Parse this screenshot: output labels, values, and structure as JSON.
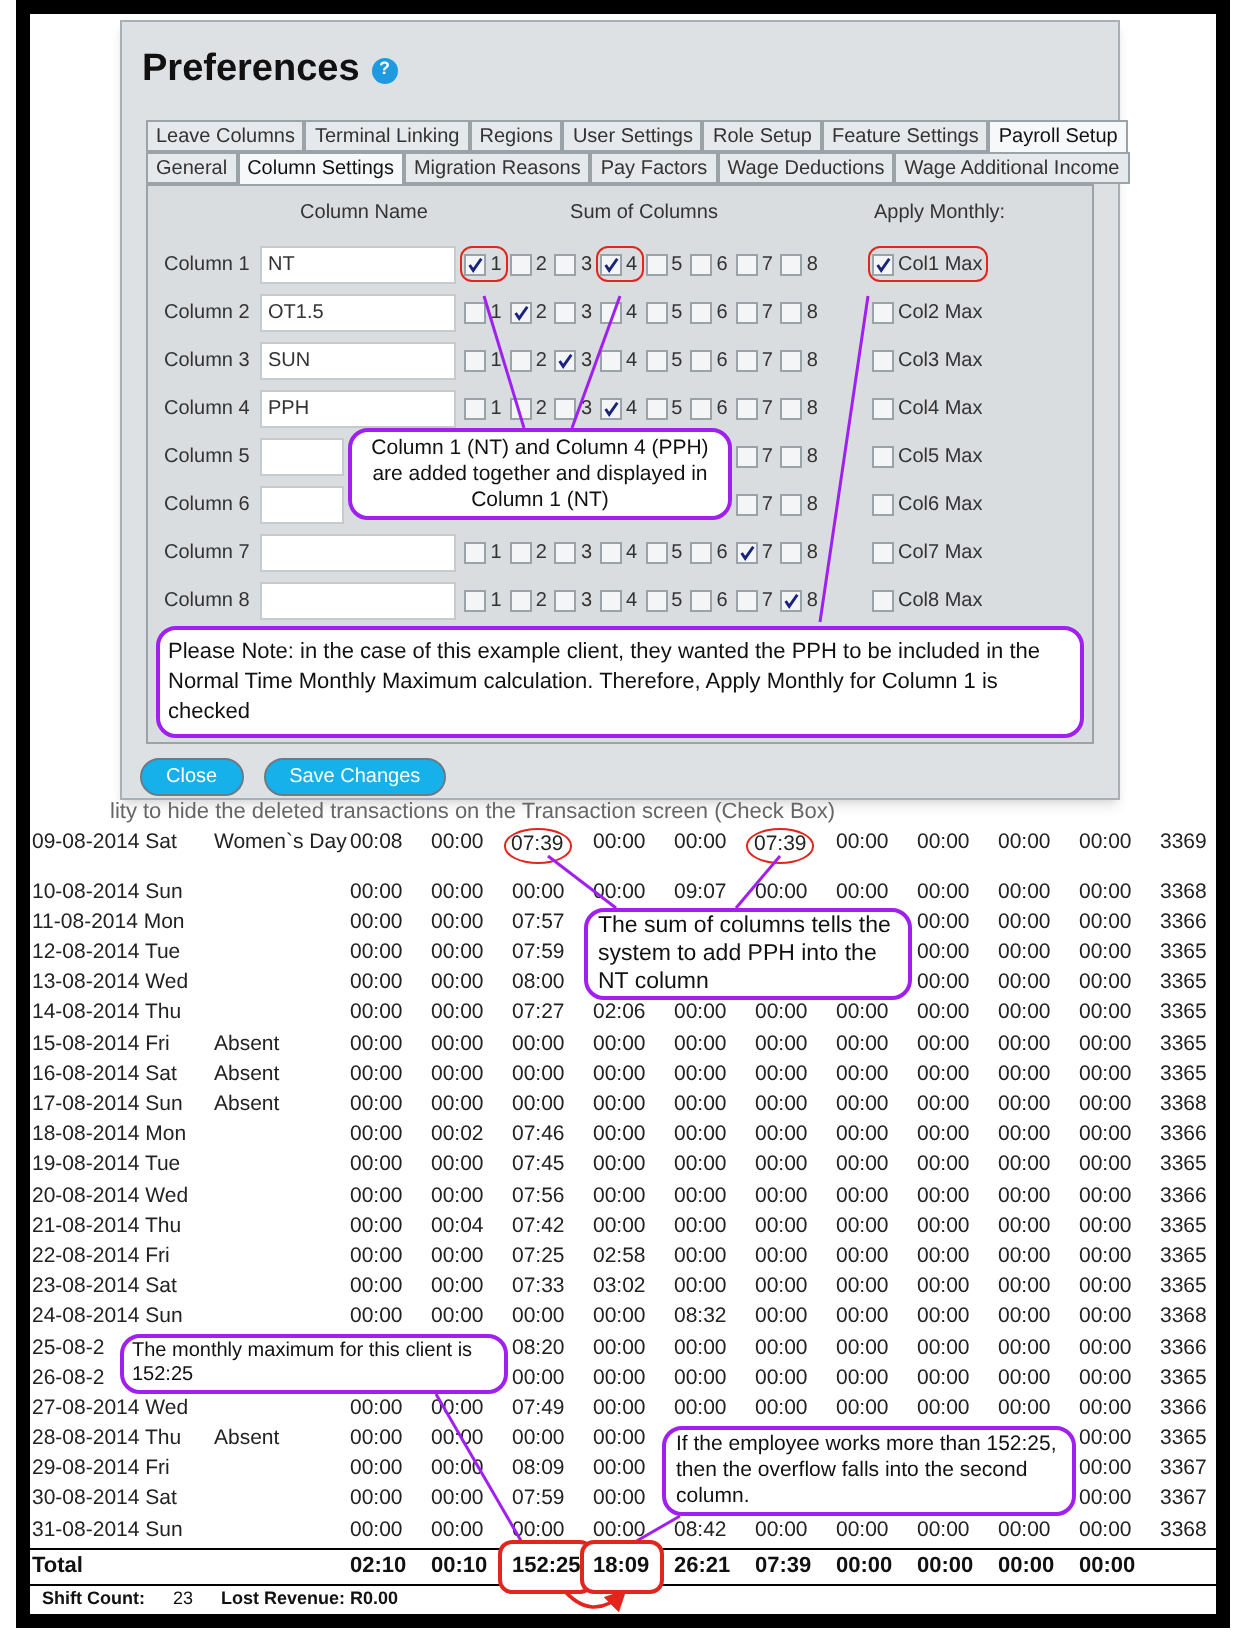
{
  "dialog": {
    "title": "Preferences",
    "help_icon": "?",
    "tab_rows": [
      [
        {
          "label": "Leave Columns",
          "selected": false
        },
        {
          "label": "Terminal Linking",
          "selected": false
        },
        {
          "label": "Regions",
          "selected": false
        },
        {
          "label": "User Settings",
          "selected": false
        },
        {
          "label": "Role Setup",
          "selected": false
        },
        {
          "label": "Feature Settings",
          "selected": false
        },
        {
          "label": "Payroll Setup",
          "selected": true
        }
      ],
      [
        {
          "label": "General",
          "selected": false
        },
        {
          "label": "Column Settings",
          "selected": true
        },
        {
          "label": "Migration Reasons",
          "selected": false
        },
        {
          "label": "Pay Factors",
          "selected": false
        },
        {
          "label": "Wage Deductions",
          "selected": false
        },
        {
          "label": "Wage Additional Income",
          "selected": false
        }
      ]
    ],
    "headers": {
      "name": "Column Name",
      "sums": "Sum of Columns",
      "monthly": "Apply Monthly:"
    },
    "rows": [
      {
        "label": "Column 1",
        "value": "NT",
        "sums": [
          {
            "label": "1",
            "checked": true,
            "circled": true
          },
          {
            "label": "2",
            "checked": false,
            "circled": false
          },
          {
            "label": "3",
            "checked": false,
            "circled": false
          },
          {
            "label": "4",
            "checked": true,
            "circled": true
          },
          {
            "label": "5",
            "checked": false,
            "circled": false
          },
          {
            "label": "6",
            "checked": false,
            "circled": false
          },
          {
            "label": "7",
            "checked": false,
            "circled": false
          },
          {
            "label": "8",
            "checked": false,
            "circled": false
          }
        ],
        "monthly": {
          "label": "Col1 Max",
          "checked": true,
          "circled": true
        }
      },
      {
        "label": "Column 2",
        "value": "OT1.5",
        "sums": [
          {
            "label": "1",
            "checked": false,
            "circled": false
          },
          {
            "label": "2",
            "checked": true,
            "circled": false
          },
          {
            "label": "3",
            "checked": false,
            "circled": false
          },
          {
            "label": "4",
            "checked": false,
            "circled": false
          },
          {
            "label": "5",
            "checked": false,
            "circled": false
          },
          {
            "label": "6",
            "checked": false,
            "circled": false
          },
          {
            "label": "7",
            "checked": false,
            "circled": false
          },
          {
            "label": "8",
            "checked": false,
            "circled": false
          }
        ],
        "monthly": {
          "label": "Col2 Max",
          "checked": false,
          "circled": false
        }
      },
      {
        "label": "Column 3",
        "value": "SUN",
        "sums": [
          {
            "label": "1",
            "checked": false,
            "circled": false
          },
          {
            "label": "2",
            "checked": false,
            "circled": false
          },
          {
            "label": "3",
            "checked": true,
            "circled": false
          },
          {
            "label": "4",
            "checked": false,
            "circled": false
          },
          {
            "label": "5",
            "checked": false,
            "circled": false
          },
          {
            "label": "6",
            "checked": false,
            "circled": false
          },
          {
            "label": "7",
            "checked": false,
            "circled": false
          },
          {
            "label": "8",
            "checked": false,
            "circled": false
          }
        ],
        "monthly": {
          "label": "Col3 Max",
          "checked": false,
          "circled": false
        }
      },
      {
        "label": "Column 4",
        "value": "PPH",
        "sums": [
          {
            "label": "1",
            "checked": false,
            "circled": false
          },
          {
            "label": "2",
            "checked": false,
            "circled": false
          },
          {
            "label": "3",
            "checked": false,
            "circled": false
          },
          {
            "label": "4",
            "checked": true,
            "circled": false
          },
          {
            "label": "5",
            "checked": false,
            "circled": false
          },
          {
            "label": "6",
            "checked": false,
            "circled": false
          },
          {
            "label": "7",
            "checked": false,
            "circled": false
          },
          {
            "label": "8",
            "checked": false,
            "circled": false
          }
        ],
        "monthly": {
          "label": "Col4 Max",
          "checked": false,
          "circled": false
        }
      },
      {
        "label": "Column 5",
        "sums": [
          {
            "label": "7",
            "checked": false,
            "circled": false
          },
          {
            "label": "8",
            "checked": false,
            "circled": false
          }
        ],
        "monthly": {
          "label": "Col5 Max",
          "checked": false,
          "circled": false
        }
      },
      {
        "label": "Column 6",
        "sums": [
          {
            "label": "7",
            "checked": false,
            "circled": false
          },
          {
            "label": "8",
            "checked": false,
            "circled": false
          }
        ],
        "monthly": {
          "label": "Col6 Max",
          "checked": false,
          "circled": false
        }
      },
      {
        "label": "Column 7",
        "sums": [
          {
            "label": "1",
            "checked": false,
            "circled": false
          },
          {
            "label": "2",
            "checked": false,
            "circled": false
          },
          {
            "label": "3",
            "checked": false,
            "circled": false
          },
          {
            "label": "4",
            "checked": false,
            "circled": false
          },
          {
            "label": "5",
            "checked": false,
            "circled": false
          },
          {
            "label": "6",
            "checked": false,
            "circled": false
          },
          {
            "label": "7",
            "checked": true,
            "circled": false
          },
          {
            "label": "8",
            "checked": false,
            "circled": false
          }
        ],
        "monthly": {
          "label": "Col7 Max",
          "checked": false,
          "circled": false
        }
      },
      {
        "label": "Column 8",
        "sums": [
          {
            "label": "1",
            "checked": false,
            "circled": false
          },
          {
            "label": "2",
            "checked": false,
            "circled": false
          },
          {
            "label": "3",
            "checked": false,
            "circled": false
          },
          {
            "label": "4",
            "checked": false,
            "circled": false
          },
          {
            "label": "5",
            "checked": false,
            "circled": false
          },
          {
            "label": "6",
            "checked": false,
            "circled": false
          },
          {
            "label": "7",
            "checked": false,
            "circled": false
          },
          {
            "label": "8",
            "checked": true,
            "circled": false
          }
        ],
        "monthly": {
          "label": "Col8 Max",
          "checked": false,
          "circled": false
        }
      }
    ],
    "callout": "Column 1 (NT) and Column 4 (PPH) are added together and displayed in Column 1 (NT)",
    "note": "Please Note: in the case of this example client, they wanted the PPH to be included in the Normal Time Monthly Maximum calculation.  Therefore, Apply Monthly for Column 1 is checked",
    "buttons": [
      "Close",
      "Save Changes"
    ]
  },
  "report": {
    "cut_line": "lity to hide the deleted transactions on the Transaction screen (Check Box)",
    "rows": [
      {
        "date": "09-08-2014 Sat",
        "remark": "Women`s Day",
        "times": [
          "00:08",
          "00:00",
          "07:39",
          "00:00",
          "00:00",
          "07:39",
          "00:00",
          "00:00",
          "00:00",
          "00:00"
        ],
        "code": "3369",
        "circled": [
          false,
          false,
          true,
          false,
          false,
          true,
          false,
          false,
          false,
          false
        ]
      },
      {
        "date": "10-08-2014 Sun",
        "times": [
          "00:00",
          "00:00",
          "00:00",
          "00:00",
          "09:07",
          "00:00",
          "00:00",
          "00:00",
          "00:00",
          "00:00"
        ],
        "code": "3368"
      },
      {
        "date": "11-08-2014 Mon",
        "times_left": [
          "00:00",
          "00:00",
          "07:57"
        ],
        "times_right": [
          "00:00",
          "00:00",
          "00:00"
        ],
        "code": "3366"
      },
      {
        "date": "12-08-2014 Tue",
        "times_left": [
          "00:00",
          "00:00",
          "07:59"
        ],
        "times_right": [
          "00:00",
          "00:00",
          "00:00"
        ],
        "code": "3365"
      },
      {
        "date": "13-08-2014 Wed",
        "times_left": [
          "00:00",
          "00:00",
          "08:00"
        ],
        "times_right": [
          "00:00",
          "00:00",
          "00:00"
        ],
        "code": "3365"
      },
      {
        "date": "14-08-2014 Thu",
        "times": [
          "00:00",
          "00:00",
          "07:27",
          "02:06",
          "00:00",
          "00:00",
          "00:00",
          "00:00",
          "00:00",
          "00:00"
        ],
        "code": "3365"
      },
      {
        "date": "15-08-2014 Fri",
        "remark": "Absent",
        "times": [
          "00:00",
          "00:00",
          "00:00",
          "00:00",
          "00:00",
          "00:00",
          "00:00",
          "00:00",
          "00:00",
          "00:00"
        ],
        "code": "3365"
      },
      {
        "date": "16-08-2014 Sat",
        "remark": "Absent",
        "times": [
          "00:00",
          "00:00",
          "00:00",
          "00:00",
          "00:00",
          "00:00",
          "00:00",
          "00:00",
          "00:00",
          "00:00"
        ],
        "code": "3365"
      },
      {
        "date": "17-08-2014 Sun",
        "remark": "Absent",
        "times": [
          "00:00",
          "00:00",
          "00:00",
          "00:00",
          "00:00",
          "00:00",
          "00:00",
          "00:00",
          "00:00",
          "00:00"
        ],
        "code": "3368"
      },
      {
        "date": "18-08-2014 Mon",
        "times": [
          "00:00",
          "00:02",
          "07:46",
          "00:00",
          "00:00",
          "00:00",
          "00:00",
          "00:00",
          "00:00",
          "00:00"
        ],
        "code": "3366"
      },
      {
        "date": "19-08-2014 Tue",
        "times": [
          "00:00",
          "00:00",
          "07:45",
          "00:00",
          "00:00",
          "00:00",
          "00:00",
          "00:00",
          "00:00",
          "00:00"
        ],
        "code": "3365"
      },
      {
        "date": "20-08-2014 Wed",
        "times": [
          "00:00",
          "00:00",
          "07:56",
          "00:00",
          "00:00",
          "00:00",
          "00:00",
          "00:00",
          "00:00",
          "00:00"
        ],
        "code": "3366"
      },
      {
        "date": "21-08-2014 Thu",
        "times": [
          "00:00",
          "00:04",
          "07:42",
          "00:00",
          "00:00",
          "00:00",
          "00:00",
          "00:00",
          "00:00",
          "00:00"
        ],
        "code": "3365"
      },
      {
        "date": "22-08-2014 Fri",
        "times": [
          "00:00",
          "00:00",
          "07:25",
          "02:58",
          "00:00",
          "00:00",
          "00:00",
          "00:00",
          "00:00",
          "00:00"
        ],
        "code": "3365"
      },
      {
        "date": "23-08-2014 Sat",
        "times": [
          "00:00",
          "00:00",
          "07:33",
          "03:02",
          "00:00",
          "00:00",
          "00:00",
          "00:00",
          "00:00",
          "00:00"
        ],
        "code": "3365"
      },
      {
        "date": "24-08-2014 Sun",
        "times": [
          "00:00",
          "00:00",
          "00:00",
          "00:00",
          "08:32",
          "00:00",
          "00:00",
          "00:00",
          "00:00",
          "00:00"
        ],
        "code": "3368"
      },
      {
        "date": "25-08-2",
        "times_right": [
          "08:20",
          "00:00",
          "00:00",
          "00:00",
          "00:00",
          "00:00",
          "00:00",
          "00:00"
        ],
        "code": "3366"
      },
      {
        "date": "26-08-2",
        "times_right": [
          "00:00",
          "00:00",
          "00:00",
          "00:00",
          "00:00",
          "00:00",
          "00:00",
          "00:00"
        ],
        "code": "3365"
      },
      {
        "date": "27-08-2014 Wed",
        "times": [
          "00:00",
          "00:00",
          "07:49",
          "00:00",
          "00:00",
          "00:00",
          "00:00",
          "00:00",
          "00:00",
          "00:00"
        ],
        "code": "3366"
      },
      {
        "date": "28-08-2014 Thu",
        "remark": "Absent",
        "times_left": [
          "00:00",
          "00:00",
          "00:00",
          "00:00"
        ],
        "times_right": [
          "00:00"
        ],
        "code": "3365"
      },
      {
        "date": "29-08-2014 Fri",
        "times_left": [
          "00:00",
          "00:00",
          "08:09",
          "00:00"
        ],
        "times_right": [
          "00:00"
        ],
        "code": "3367"
      },
      {
        "date": "30-08-2014 Sat",
        "times_left": [
          "00:00",
          "00:00",
          "07:59",
          "00:00"
        ],
        "times_right": [
          "00:00"
        ],
        "code": "3367"
      },
      {
        "date": "31-08-2014 Sun",
        "times": [
          "00:00",
          "00:00",
          "00:00",
          "00:00",
          "08:42",
          "00:00",
          "00:00",
          "00:00",
          "00:00",
          "00:00"
        ],
        "code": "3368"
      }
    ],
    "total": {
      "label": "Total",
      "times": [
        "02:10",
        "00:10",
        "152:25",
        "18:09",
        "26:21",
        "07:39",
        "00:00",
        "00:00",
        "00:00",
        "00:00"
      ],
      "circled": [
        false,
        false,
        true,
        true,
        false,
        false,
        false,
        false,
        false,
        false
      ]
    },
    "footer": {
      "shift_label": "Shift Count:",
      "shift_value": "23",
      "revenue": "Lost Revenue: R0.00"
    },
    "callouts": [
      "The sum of columns tells the system to add PPH into the NT column",
      "The monthly maximum for this client is 152:25",
      "If the employee works more than 152:25, then the overflow falls into the second column."
    ]
  }
}
